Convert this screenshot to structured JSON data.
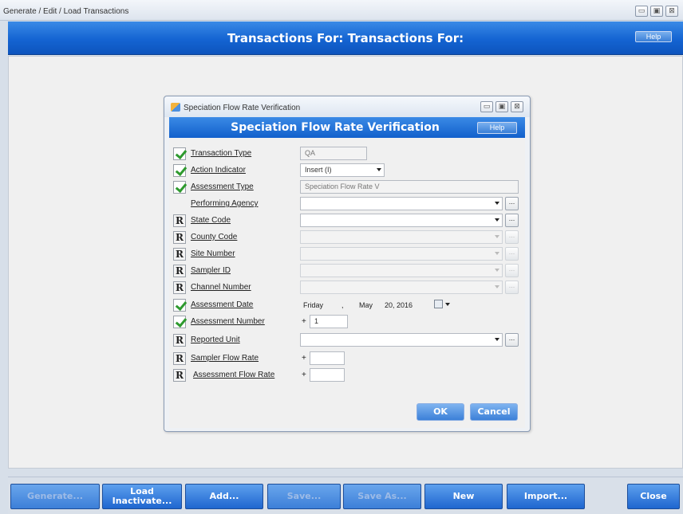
{
  "window": {
    "title": "Generate / Edit / Load Transactions",
    "banner_title": "Transactions For: Transactions For:",
    "help_label": "Help"
  },
  "window_controls": {
    "minimize": "▭",
    "maximize": "▣",
    "close": "⊠"
  },
  "dialog": {
    "title": "Speciation Flow Rate Verification",
    "banner_title": "Speciation Flow Rate Verification",
    "help_label": "Help",
    "fields": {
      "transaction_type": {
        "label": "Transaction Type",
        "value": "QA",
        "badge": "check"
      },
      "action_indicator": {
        "label": "Action Indicator",
        "value": "Insert (I)",
        "badge": "check"
      },
      "assessment_type": {
        "label": "Assessment Type",
        "value": "Speciation Flow Rate V",
        "badge": "check"
      },
      "performing_agency": {
        "label": "Performing Agency",
        "value": "",
        "badge": "none"
      },
      "state_code": {
        "label": "State Code",
        "value": "",
        "badge": "R"
      },
      "county_code": {
        "label": "County Code",
        "value": "",
        "badge": "R"
      },
      "site_number": {
        "label": "Site Number",
        "value": "",
        "badge": "R"
      },
      "sampler_id": {
        "label": "Sampler ID",
        "value": "",
        "badge": "R"
      },
      "channel_number": {
        "label": "Channel Number",
        "value": "",
        "badge": "R"
      },
      "assessment_date": {
        "label": "Assessment Date",
        "weekday": "Friday",
        "sep": ",",
        "month": "May",
        "day_year": "20, 2016",
        "badge": "check"
      },
      "assessment_number": {
        "label": "Assessment Number",
        "value": "1",
        "badge": "check"
      },
      "reported_unit": {
        "label": "Reported Unit",
        "value": "",
        "badge": "R"
      },
      "sampler_flow_rate": {
        "label": "Sampler Flow Rate",
        "value": "",
        "badge": "R"
      },
      "assessment_flow_rate": {
        "label": "Assessment Flow Rate",
        "value": "",
        "badge": "R"
      }
    },
    "plus_sign": "+",
    "ellipsis": "...",
    "ok_label": "OK",
    "cancel_label": "Cancel"
  },
  "bottom_buttons": {
    "generate": "Generate...",
    "load_line1": "Load",
    "load_line2": "Inactivate...",
    "add": "Add...",
    "save": "Save...",
    "save_as": "Save As...",
    "new": "New",
    "import": "Import...",
    "close": "Close"
  }
}
